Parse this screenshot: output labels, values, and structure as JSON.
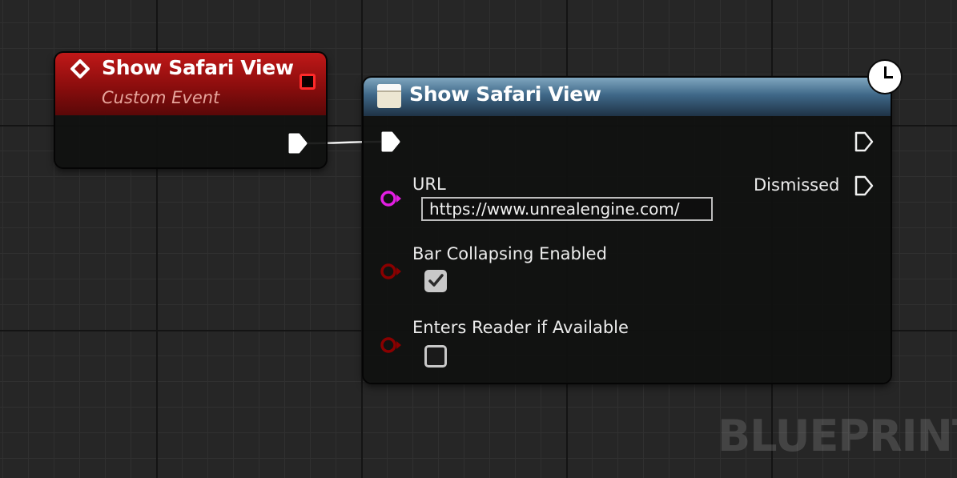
{
  "event_node": {
    "title": "Show Safari View",
    "subtitle": "Custom Event",
    "header_color": "#a01212",
    "icon": "custom-event-diamond-icon",
    "delegate_pin_color": "#ff2a2a"
  },
  "function_node": {
    "title": "Show Safari View",
    "header_color": "#4a7596",
    "icon": "function-icon",
    "latent_icon": "clock-icon",
    "inputs": [
      {
        "label": "URL",
        "type": "string",
        "pin_color": "#e31ee3",
        "value": "https://www.unrealengine.com/"
      },
      {
        "label": "Bar Collapsing Enabled",
        "type": "bool",
        "pin_color": "#8a0000",
        "checked": true
      },
      {
        "label": "Enters Reader if Available",
        "type": "bool",
        "pin_color": "#8a0000",
        "checked": false
      }
    ],
    "outputs": [
      {
        "label": "Dismissed",
        "type": "exec"
      }
    ]
  },
  "watermark": "BLUEPRINT"
}
